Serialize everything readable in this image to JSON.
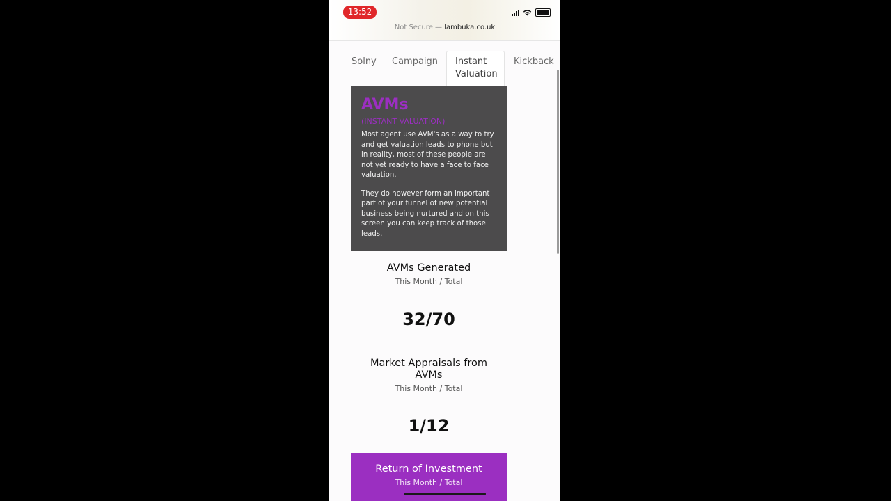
{
  "status_bar": {
    "time": "13:52",
    "url_prefix": "Not Secure —",
    "url_domain": "lambuka.co.uk"
  },
  "tabs": [
    {
      "label": "Solny"
    },
    {
      "label": "Campaign"
    },
    {
      "label": "Instant Valuation",
      "active": true
    },
    {
      "label": "Kickback"
    }
  ],
  "avm_card": {
    "title": "AVMs",
    "subtitle": "(INSTANT VALUATION)",
    "paragraph1": "Most agent use AVM's as a way to try and get valuation leads to phone but in reality, most of these people are not yet ready to have a face to face valuation.",
    "paragraph2": "They do however form an important part of your funnel of new potential business being nurtured and on this screen you can keep track of those leads."
  },
  "stats": [
    {
      "title": "AVMs Generated",
      "subtitle": "This Month / Total",
      "value": "32/70"
    },
    {
      "title": "Market Appraisals from AVMs",
      "subtitle": "This Month / Total",
      "value": "1/12"
    }
  ],
  "roi": {
    "title": "Return of Investment",
    "subtitle": "This Month / Total"
  },
  "colors": {
    "accent": "#9b2fc1",
    "card_bg": "#4c4b4c",
    "time_pill": "#e0272a"
  },
  "icons": [
    "signal-icon",
    "wifi-icon",
    "battery-icon"
  ]
}
